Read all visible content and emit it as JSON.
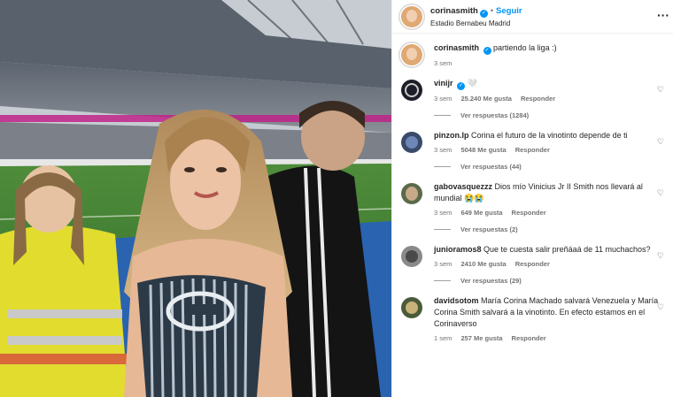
{
  "post": {
    "username": "corinasmith",
    "follow_label": "Seguir",
    "separator": "•",
    "location": "Estadio Bernabeu Madrid",
    "more": "···",
    "caption": "partiendo la liga :)",
    "caption_time": "3 sem"
  },
  "comments": [
    {
      "username": "vinijr",
      "text": "🤍",
      "verified": true,
      "time": "3 sem",
      "likes": "25.240 Me gusta",
      "reply": "Responder",
      "replies": "Ver respuestas (1284)",
      "avatar_color": "#1e1e2a"
    },
    {
      "username": "pinzon.lp",
      "text": "Corina el futuro de la vinotinto depende de ti",
      "verified": false,
      "time": "3 sem",
      "likes": "5048 Me gusta",
      "reply": "Responder",
      "replies": "Ver respuestas (44)",
      "avatar_color": "#3a4a6a"
    },
    {
      "username": "gabovasquezzz",
      "text": "Dios mío Vinicius Jr II Smith nos llevará al mundial 😭😭",
      "verified": false,
      "time": "3 sem",
      "likes": "649 Me gusta",
      "reply": "Responder",
      "replies": "Ver respuestas (2)",
      "avatar_color": "#5a6b4a"
    },
    {
      "username": "junioramos8",
      "text": "Que te cuesta salir preñáaá de 11 muchachos?",
      "verified": false,
      "time": "3 sem",
      "likes": "2410 Me gusta",
      "reply": "Responder",
      "replies": "Ver respuestas (29)",
      "avatar_color": "#8a8a8a"
    },
    {
      "username": "davidsotom",
      "text": "María Corina Machado salvará Venezuela y María Corina Smith salvará a la vinotinto. En efecto estamos en el Corinaverso",
      "verified": false,
      "time": "1 sem",
      "likes": "257 Me gusta",
      "reply": "Responder",
      "replies": "",
      "avatar_color": "#4a5a3a"
    }
  ],
  "colors": {
    "accent": "#0095f6",
    "muted": "#737373",
    "text": "#262626"
  }
}
